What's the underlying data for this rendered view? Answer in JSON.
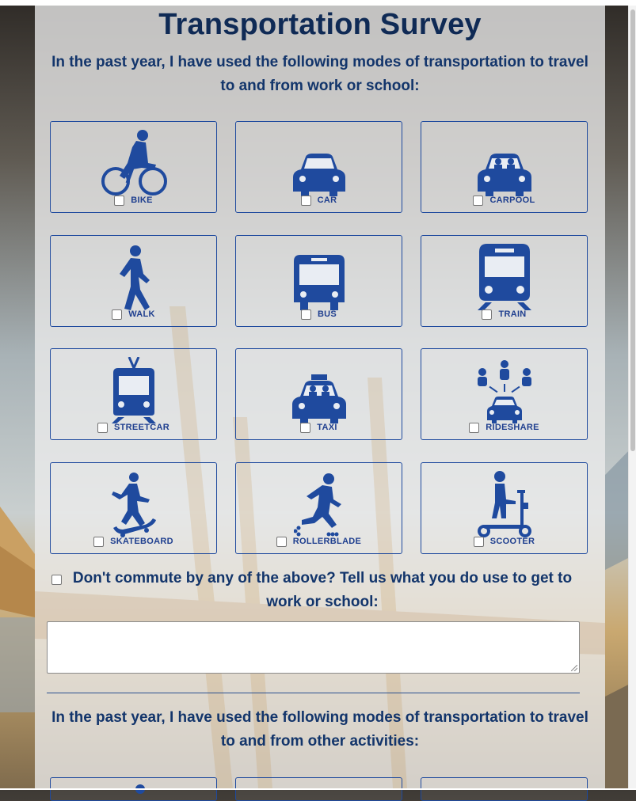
{
  "survey": {
    "title": "Transportation Survey",
    "question_work": "In the past year, I have used the following modes of transportation to travel to and from work or school:",
    "modes": [
      {
        "label": "BIKE",
        "icon": "bike-icon"
      },
      {
        "label": "CAR",
        "icon": "car-icon"
      },
      {
        "label": "CARPOOL",
        "icon": "carpool-icon"
      },
      {
        "label": "WALK",
        "icon": "walk-icon"
      },
      {
        "label": "BUS",
        "icon": "bus-icon"
      },
      {
        "label": "TRAIN",
        "icon": "train-icon"
      },
      {
        "label": "STREETCAR",
        "icon": "streetcar-icon"
      },
      {
        "label": "TAXI",
        "icon": "taxi-icon"
      },
      {
        "label": "RIDESHARE",
        "icon": "rideshare-icon"
      },
      {
        "label": "SKATEBOARD",
        "icon": "skateboard-icon"
      },
      {
        "label": "ROLLERBLADE",
        "icon": "rollerblade-icon"
      },
      {
        "label": "SCOOTER",
        "icon": "scooter-icon"
      }
    ],
    "other_prompt": "Don't commute by any of the above? Tell us what you do use to get to work or school:",
    "other_value": "",
    "question_activities": "In the past year, I have used the following modes of transportation to travel to and from other activities:"
  },
  "colors": {
    "icon": "#1f4a9e",
    "title": "#0f2a55",
    "question": "#13356b"
  }
}
